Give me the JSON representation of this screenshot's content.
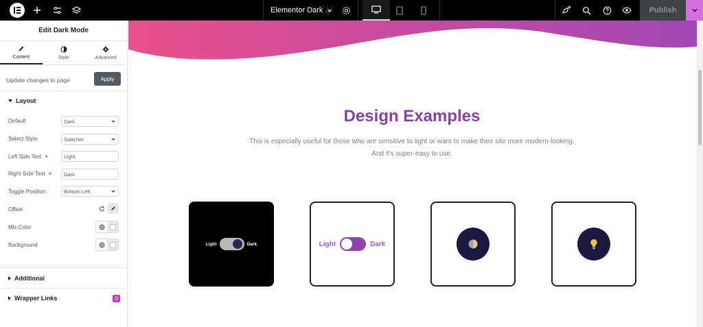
{
  "topbar": {
    "icons": [
      "elementor-logo-icon",
      "add-icon",
      "sliders-icon",
      "layers-icon"
    ],
    "doc_title": "Elementor Dark ...",
    "devices": [
      "desktop-icon",
      "tablet-icon",
      "mobile-icon"
    ],
    "active_device": "desktop",
    "right_icons": [
      "notifications-icon",
      "search-icon",
      "help-icon",
      "preview-icon"
    ],
    "publish_label": "Publish",
    "accent": "#d56fe0"
  },
  "sidebar": {
    "title": "Edit Dark Mode",
    "tabs": [
      {
        "label": "Content",
        "icon": "pencil-icon"
      },
      {
        "label": "Style",
        "icon": "contrast-icon"
      },
      {
        "label": "Advanced",
        "icon": "gear-icon"
      }
    ],
    "active_tab": "Content",
    "update_text": "Update changes to page",
    "apply_label": "Apply",
    "layout_section": "Layout",
    "controls": {
      "default": {
        "label": "Default",
        "value": "Dark"
      },
      "select_style": {
        "label": "Select Style",
        "value": "Switcher"
      },
      "left_side_text": {
        "label": "Left Side Text",
        "value": "Light"
      },
      "right_side_text": {
        "label": "Right Side Text",
        "value": "Dark"
      },
      "toggle_position": {
        "label": "Toggle Position",
        "value": "Bottom Left"
      },
      "offset": {
        "label": "Offset"
      },
      "mix_color": {
        "label": "Mix Color"
      },
      "background": {
        "label": "Background"
      }
    },
    "additional_section": "Additional",
    "wrapper_links_section": "Wrapper Links"
  },
  "canvas": {
    "heading": "Design Examples",
    "subtext_line1": "This is especially useful for those who are sensitive to light or want to make their site more modern-looking.",
    "subtext_line2": "And it's super-easy to use.",
    "heading_color": "#8a3ea8",
    "cards": [
      {
        "left_text": "Light",
        "right_text": "Dark"
      },
      {
        "left_text": "Light",
        "right_text": "Dark"
      },
      {
        "icon": "half-moon-contrast-icon"
      },
      {
        "icon": "lightbulb-icon"
      }
    ]
  }
}
